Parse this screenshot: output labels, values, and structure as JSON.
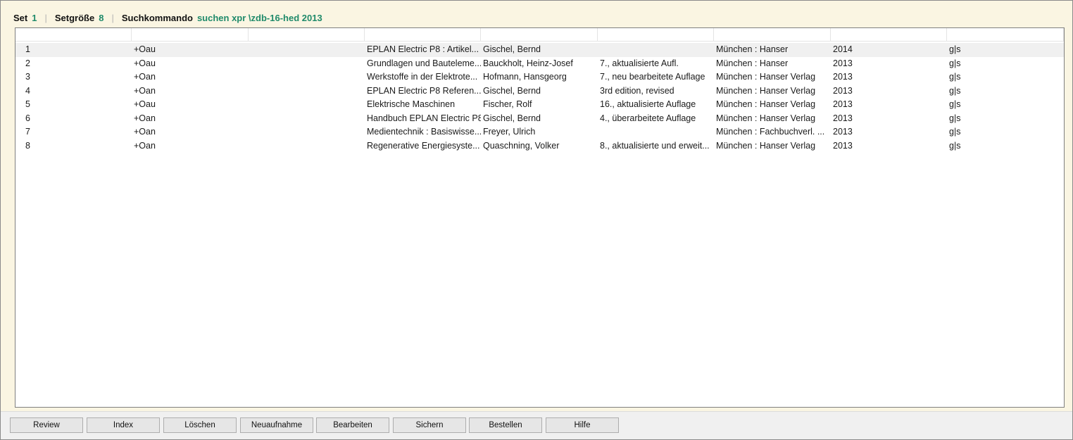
{
  "info_bar": {
    "set_label": "Set",
    "set_value": "1",
    "size_label": "Setgröße",
    "size_value": "8",
    "command_label": "Suchkommando",
    "command_value": "suchen xpr \\zdb-16-hed 2013"
  },
  "table": {
    "columns": [
      "",
      "",
      "",
      "",
      "",
      "",
      "",
      "",
      ""
    ],
    "selected_row": 0,
    "rows": [
      [
        "1",
        "+Oau",
        "",
        "EPLAN Electric P8 : Artikel...",
        "Gischel, Bernd",
        "",
        "München : Hanser",
        "2014",
        "g|s"
      ],
      [
        "2",
        "+Oau",
        "",
        "Grundlagen und Bauteleme...",
        "Bauckholt, Heinz-Josef",
        "7., aktualisierte Aufl.",
        "München : Hanser",
        "2013",
        "g|s"
      ],
      [
        "3",
        "+Oan",
        "",
        "Werkstoffe in der Elektrote...",
        "Hofmann, Hansgeorg",
        "7., neu bearbeitete Auflage",
        "München : Hanser Verlag",
        "2013",
        "g|s"
      ],
      [
        "4",
        "+Oan",
        "",
        "EPLAN Electric P8 Referen...",
        "Gischel, Bernd",
        "3rd edition, revised",
        "München : Hanser Verlag",
        "2013",
        "g|s"
      ],
      [
        "5",
        "+Oau",
        "",
        "Elektrische Maschinen",
        "Fischer, Rolf",
        "16., aktualisierte Auflage",
        "München : Hanser Verlag",
        "2013",
        "g|s"
      ],
      [
        "6",
        "+Oan",
        "",
        "Handbuch EPLAN Electric P8",
        "Gischel, Bernd",
        "4., überarbeitete Auflage",
        "München : Hanser Verlag",
        "2013",
        "g|s"
      ],
      [
        "7",
        "+Oan",
        "",
        "Medientechnik : Basiswisse...",
        "Freyer, Ulrich",
        "",
        "München : Fachbuchverl. ...",
        "2013",
        "g|s"
      ],
      [
        "8",
        "+Oan",
        "",
        "Regenerative Energiesyste...",
        "Quaschning, Volker",
        "8., aktualisierte und erweit...",
        "München : Hanser Verlag",
        "2013",
        "g|s"
      ]
    ]
  },
  "buttons": {
    "review": "Review",
    "index": "Index",
    "delete": "Löschen",
    "new_record": "Neuaufnahme",
    "edit": "Bearbeiten",
    "save": "Sichern",
    "order": "Bestellen",
    "help": "Hilfe"
  }
}
